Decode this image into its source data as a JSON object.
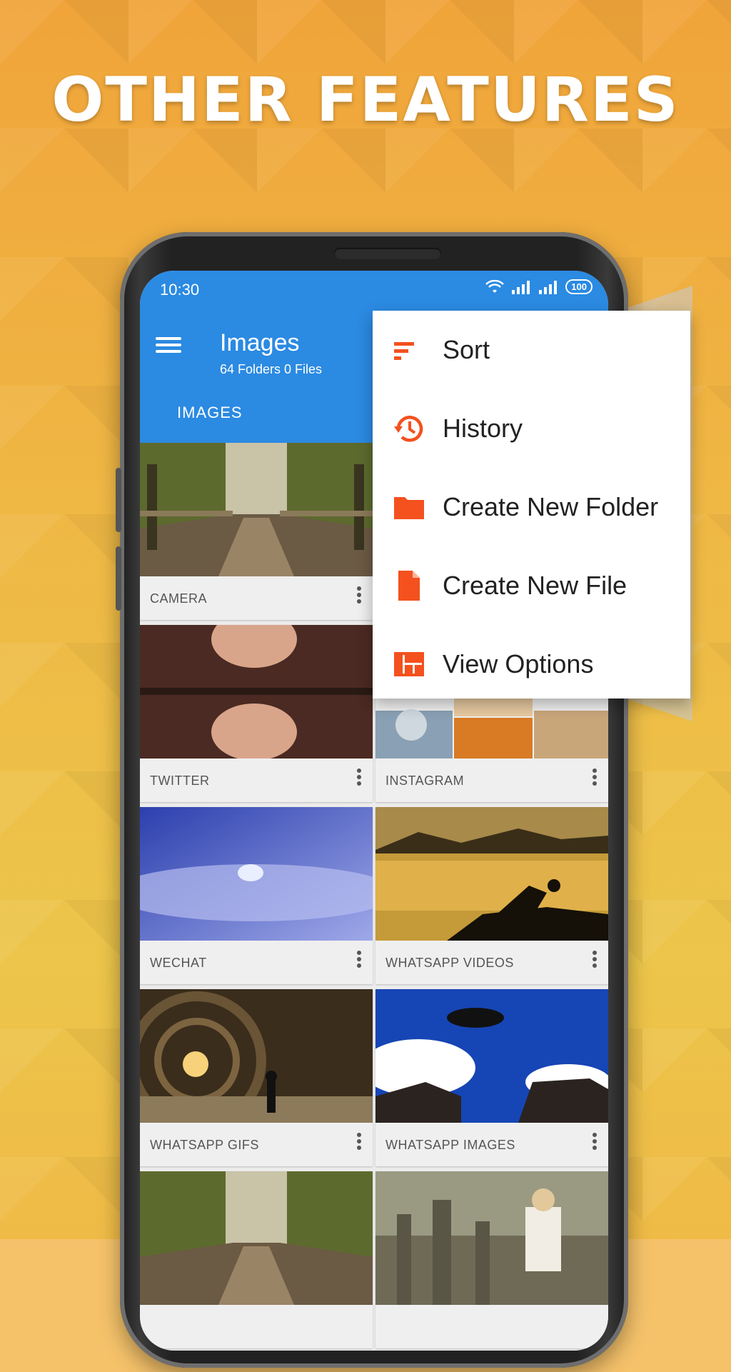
{
  "headline": "OTHER FEATURES",
  "status_bar": {
    "time": "10:30",
    "battery": "100"
  },
  "app_bar": {
    "title": "Images",
    "subtitle": "64 Folders 0 Files",
    "tab": "IMAGES"
  },
  "folders": [
    {
      "label": "CAMERA"
    },
    {
      "label": ""
    },
    {
      "label": "TWITTER"
    },
    {
      "label": "INSTAGRAM"
    },
    {
      "label": "WECHAT"
    },
    {
      "label": "WHATSAPP VIDEOS"
    },
    {
      "label": "WHATSAPP GIFS"
    },
    {
      "label": "WHATSAPP IMAGES"
    }
  ],
  "menu": {
    "items": [
      {
        "label": "Sort",
        "icon": "sort-icon"
      },
      {
        "label": "History",
        "icon": "history-icon"
      },
      {
        "label": "Create New Folder",
        "icon": "folder-icon"
      },
      {
        "label": "Create New File",
        "icon": "file-icon"
      },
      {
        "label": "View Options",
        "icon": "view-options-icon"
      }
    ]
  },
  "colors": {
    "accent": "#2b8ae2",
    "menu_icon": "#f4511e",
    "background": "#efb945"
  }
}
